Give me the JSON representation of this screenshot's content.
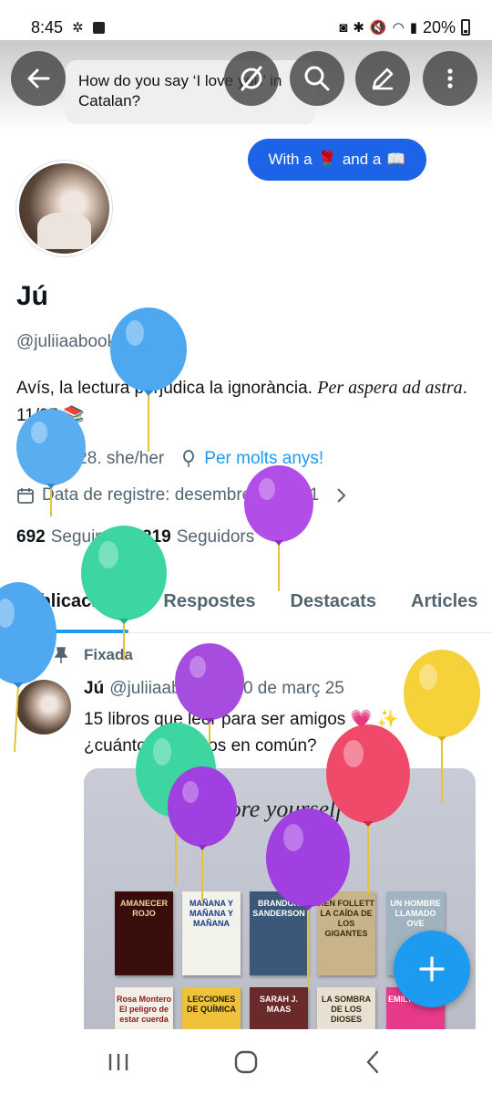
{
  "status_bar": {
    "time": "8:45",
    "battery": "20%"
  },
  "header": {
    "tooltip": "How do you say ‘I love you’ in Catalan?",
    "chip": {
      "text_before": "With a",
      "rose": "🌹",
      "text_middle": "and a",
      "book": "📖"
    }
  },
  "profile": {
    "name": "Jú",
    "handle": "@juliiaabooks",
    "bio_text": "Avís, la lectura perjudica la ignorància.",
    "bio_serif": "Per aspera ad astra",
    "bio_tail": ".  11/25",
    "bio_emoji": "📚",
    "location": "bcn. 28. she/her",
    "birthday_link": "Per molts anys!",
    "joined": "Data de registre: desembre de 2021",
    "following_count": "692",
    "following_label": "Seguint",
    "followers_count": "1.219",
    "followers_label": "Seguidors"
  },
  "tabs": [
    "Publicacions",
    "Respostes",
    "Destacats",
    "Articles"
  ],
  "post": {
    "pinned_label": "Fixada",
    "author": "Jú",
    "handle": "@juliiaabooks",
    "date": "· 10 de març 25",
    "text": "15 libros que leer para ser amigos 💗 ✨ ¿cuántos tenemos en común?",
    "media_title": "score yourself",
    "books_row1": [
      "AMANECER ROJO",
      "MAÑANA Y MAÑANA Y MAÑANA",
      "BRANDON SANDERSON",
      "KEN FOLLETT LA CAÍDA DE LOS GIGANTES",
      "UN HOMBRE LLAMADO OVE"
    ],
    "books_row2": [
      "Rosa Montero El peligro de estar cuerda",
      "LECCIONES DE QUÍMICA",
      "SARAH J. MAAS",
      "LA SOMBRA DE LOS DIOSES",
      "EMILY HAPPY"
    ]
  },
  "colors": {
    "accent": "#1d9bf0",
    "chip": "#1d63e8",
    "text": "#0f1419",
    "muted": "#536471"
  },
  "balloon_colors": [
    "#4da8f0",
    "#5aaef0",
    "#b24de8",
    "#3ed6a0",
    "#50a8f0",
    "#a64de0",
    "#f5d23a",
    "#3ed6a0",
    "#f04a6a",
    "#a040e0",
    "#a040e0"
  ]
}
